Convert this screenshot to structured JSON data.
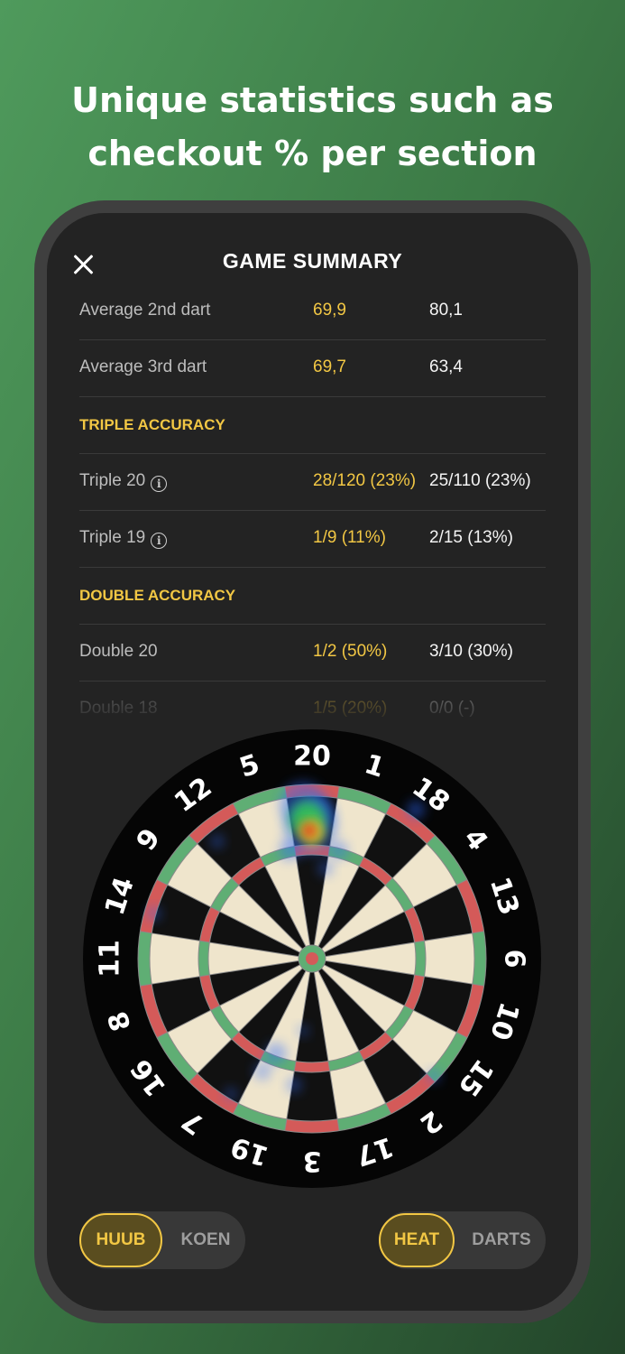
{
  "headline": [
    "Unique statistics such as",
    "checkout % per section"
  ],
  "screen_title": "GAME SUMMARY",
  "colors": {
    "accent": "#f2c744",
    "background": "#232323",
    "board_red": "#d45a59",
    "board_green": "#5fae74",
    "board_cream": "#efe5cc"
  },
  "stats": {
    "rows": [
      {
        "type": "stat",
        "label": "Average 2nd dart",
        "v1": "69,9",
        "v2": "80,1"
      },
      {
        "type": "stat",
        "label": "Average 3rd dart",
        "v1": "69,7",
        "v2": "63,4"
      },
      {
        "type": "section",
        "label": "TRIPLE ACCURACY"
      },
      {
        "type": "stat",
        "label": "Triple 20",
        "info": true,
        "v1": "28/120 (23%)",
        "v2": "25/110 (23%)"
      },
      {
        "type": "stat",
        "label": "Triple 19",
        "info": true,
        "v1": "1/9 (11%)",
        "v2": "2/15 (13%)"
      },
      {
        "type": "section",
        "label": "DOUBLE ACCURACY"
      },
      {
        "type": "stat",
        "label": "Double 20",
        "v1": "1/2 (50%)",
        "v2": "3/10 (30%)"
      },
      {
        "type": "stat",
        "label": "Double 18",
        "v1": "1/5 (20%)",
        "v2": "0/0 (-)",
        "faded": true
      }
    ],
    "info_glyph": "i"
  },
  "dartboard": {
    "numbers": [
      "20",
      "1",
      "18",
      "4",
      "13",
      "6",
      "10",
      "15",
      "2",
      "17",
      "3",
      "19",
      "7",
      "16",
      "8",
      "11",
      "14",
      "9",
      "12",
      "5"
    ]
  },
  "player_toggle": {
    "options": [
      "HUUB",
      "KOEN"
    ],
    "selected": "HUUB"
  },
  "view_toggle": {
    "options": [
      "HEAT",
      "DARTS"
    ],
    "selected": "HEAT"
  }
}
